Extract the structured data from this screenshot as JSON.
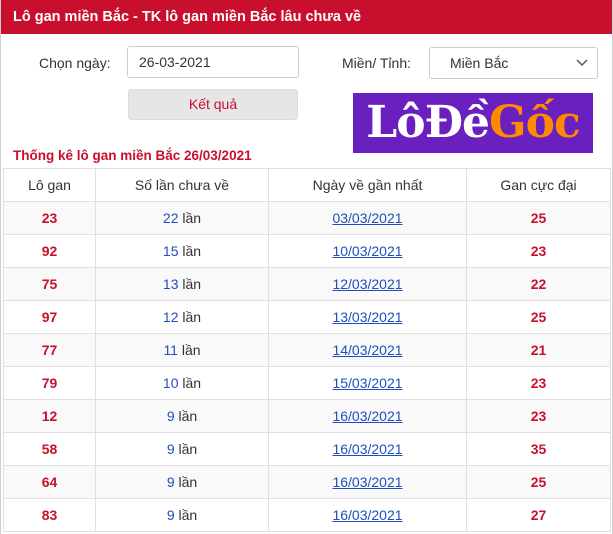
{
  "header": {
    "title": "Lô gan miền Bắc - TK lô gan miền Bắc lâu chưa về"
  },
  "form": {
    "date_label": "Chọn ngày:",
    "date_value": "26-03-2021",
    "region_label": "Miền/ Tỉnh:",
    "region_value": "Miền Bắc",
    "submit_label": "Kết quả"
  },
  "logo": {
    "part1": "Lô",
    "part2": "Đề",
    "part3": "Gốc"
  },
  "section_title": "Thống kê lô gan miền Bắc 26/03/2021",
  "table": {
    "headers": [
      "Lô gan",
      "Số lần chưa về",
      "Ngày về gần nhất",
      "Gan cực đại"
    ],
    "unit": "lần",
    "rows": [
      {
        "lo": "23",
        "count": "22",
        "date": "03/03/2021",
        "max": "25"
      },
      {
        "lo": "92",
        "count": "15",
        "date": "10/03/2021",
        "max": "23"
      },
      {
        "lo": "75",
        "count": "13",
        "date": "12/03/2021",
        "max": "22"
      },
      {
        "lo": "97",
        "count": "12",
        "date": "13/03/2021",
        "max": "25"
      },
      {
        "lo": "77",
        "count": "11",
        "date": "14/03/2021",
        "max": "21"
      },
      {
        "lo": "79",
        "count": "10",
        "date": "15/03/2021",
        "max": "23"
      },
      {
        "lo": "12",
        "count": "9",
        "date": "16/03/2021",
        "max": "23"
      },
      {
        "lo": "58",
        "count": "9",
        "date": "16/03/2021",
        "max": "35"
      },
      {
        "lo": "64",
        "count": "9",
        "date": "16/03/2021",
        "max": "25"
      },
      {
        "lo": "83",
        "count": "9",
        "date": "16/03/2021",
        "max": "27"
      }
    ]
  },
  "colors": {
    "brand_red": "#c8102e",
    "link_blue": "#1f4fbf",
    "logo_purple": "#6a1fbf",
    "logo_orange": "#ff8a00"
  },
  "icons": {
    "select_arrow": "chevron-down-icon"
  }
}
